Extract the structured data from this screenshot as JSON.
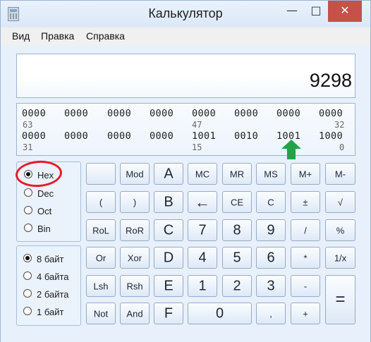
{
  "window": {
    "title": "Калькулятор",
    "controls": {
      "minimize": "—",
      "maximize": "□",
      "close": "✕"
    }
  },
  "menu": {
    "items": [
      "Вид",
      "Правка",
      "Справка"
    ]
  },
  "display": {
    "value": "9298"
  },
  "bit_panel": {
    "row1": {
      "bits": [
        "0000",
        "0000",
        "0000",
        "0000",
        "0000",
        "0000",
        "0000",
        "0000"
      ],
      "indices": [
        "63",
        "47",
        "32"
      ]
    },
    "row2": {
      "bits": [
        "0000",
        "0000",
        "0000",
        "0000",
        "1001",
        "0010",
        "1001",
        "1000"
      ],
      "indices": [
        "31",
        "15",
        "0"
      ]
    }
  },
  "radix_group": {
    "items": [
      {
        "label": "Hex",
        "selected": true
      },
      {
        "label": "Dec",
        "selected": false
      },
      {
        "label": "Oct",
        "selected": false
      },
      {
        "label": "Bin",
        "selected": false
      }
    ]
  },
  "size_group": {
    "items": [
      {
        "label": "8 байт",
        "selected": true
      },
      {
        "label": "4 байта",
        "selected": false
      },
      {
        "label": "2 байта",
        "selected": false
      },
      {
        "label": "1 байт",
        "selected": false
      }
    ]
  },
  "keys": {
    "row1": [
      "",
      "Mod",
      "A",
      "MC",
      "MR",
      "MS",
      "M+",
      "M-"
    ],
    "row2": [
      "(",
      ")",
      "B",
      "←",
      "CE",
      "C",
      "±",
      "√"
    ],
    "row3": [
      "RoL",
      "RoR",
      "C",
      "7",
      "8",
      "9",
      "/",
      "%"
    ],
    "row4": [
      "Or",
      "Xor",
      "D",
      "4",
      "5",
      "6",
      "*",
      "1/x"
    ],
    "row5": [
      "Lsh",
      "Rsh",
      "E",
      "1",
      "2",
      "3",
      "-"
    ],
    "row6": [
      "Not",
      "And",
      "F",
      "0",
      ","
    ],
    "plus": "+",
    "equals": "="
  },
  "annotations": {
    "highlight_color": "#e51b2a",
    "arrow_color": "#22a34a"
  }
}
